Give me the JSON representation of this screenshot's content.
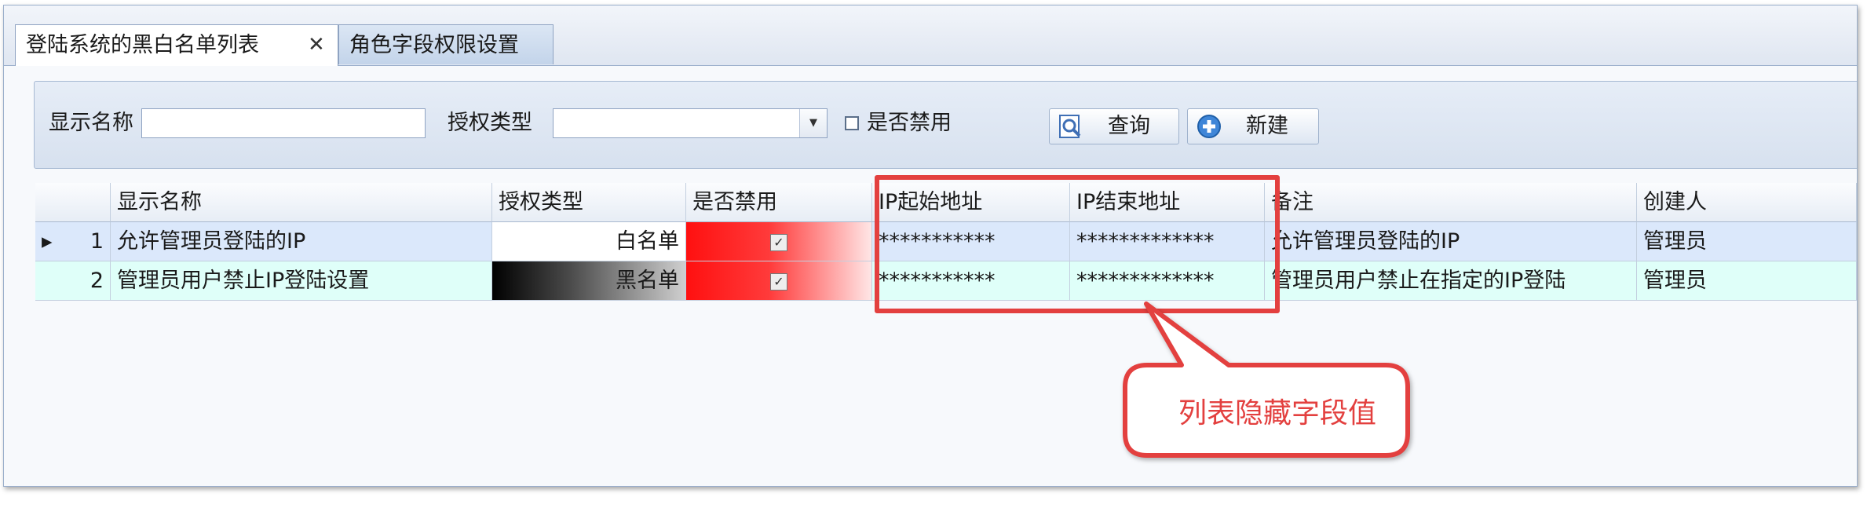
{
  "tabs": [
    {
      "label": "登陆系统的黑白名单列表",
      "close": "✕"
    },
    {
      "label": "角色字段权限设置"
    }
  ],
  "filter": {
    "display_name_label": "显示名称",
    "display_name_value": "",
    "auth_type_label": "授权类型",
    "auth_type_value": "",
    "disabled_label": "是否禁用",
    "search_button": "查询",
    "new_button": "新建"
  },
  "grid": {
    "columns": [
      "",
      "显示名称",
      "授权类型",
      "是否禁用",
      "IP起始地址",
      "IP结束地址",
      "备注",
      "创建人"
    ],
    "rows": [
      {
        "indicator": "▸",
        "num": "1",
        "name": "允许管理员登陆的IP",
        "type": "白名单",
        "disabled": true,
        "ip_start": "***********",
        "ip_end": "*************",
        "note": "允许管理员登陆的IP",
        "creator": "管理员"
      },
      {
        "indicator": "",
        "num": "2",
        "name": "管理员用户禁止IP登陆设置",
        "type": "黑名单",
        "disabled": true,
        "ip_start": "***********",
        "ip_end": "*************",
        "note": "管理员用户禁止在指定的IP登陆",
        "creator": "管理员"
      }
    ]
  },
  "annotation": {
    "text": "列表隐藏字段值",
    "color": "#e3403f"
  },
  "colors": {
    "header_bg": "#e7edf5",
    "row1_bg": "#dbe8fb",
    "row2_bg": "#dffff9"
  }
}
